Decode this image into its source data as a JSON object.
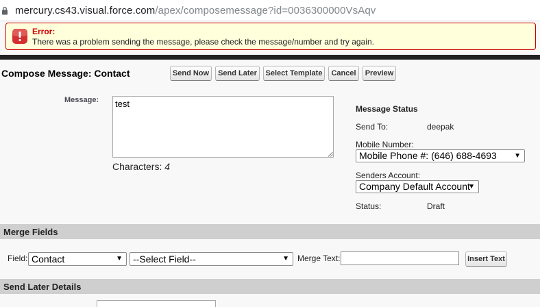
{
  "browser": {
    "url_host": "mercury.cs43.visual.force.com",
    "url_path": "/apex/composemessage?id=0036300000VsAqv"
  },
  "error": {
    "title": "Error:",
    "message": "There was a problem sending the message, please check the message/number and try again."
  },
  "header": {
    "title": "Compose Message: Contact",
    "buttons": [
      "Send Now",
      "Send Later",
      "Select Template",
      "Cancel",
      "Preview"
    ]
  },
  "message": {
    "label": "Message:",
    "value": "test",
    "characters_label": "Characters:",
    "characters_count": "4"
  },
  "status": {
    "title": "Message Status",
    "send_to_label": "Send To:",
    "send_to_value": "deepak",
    "mobile_label": "Mobile Number:",
    "mobile_value": "Mobile Phone #: (646) 688-4693",
    "senders_label": "Senders Account:",
    "senders_value": "Company Default Account",
    "status_label": "Status:",
    "status_value": "Draft"
  },
  "merge": {
    "section_title": "Merge Fields",
    "field_label": "Field:",
    "object_value": "Contact",
    "field_value": "--Select Field--",
    "merge_text_label": "Merge Text:",
    "merge_text_value": "",
    "insert_button": "Insert Text"
  },
  "send_later": {
    "section_title": "Send Later Details"
  },
  "colors": {
    "error_border": "#cc0000",
    "error_bg": "#ffffdc",
    "section_bg": "#cfcfcf"
  }
}
